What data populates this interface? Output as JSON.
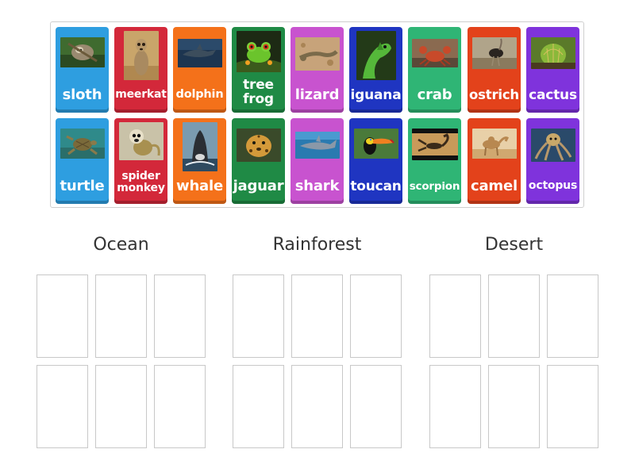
{
  "cards": [
    {
      "id": "sloth",
      "label": "sloth",
      "color": "#2e9ee0",
      "photo": "sloth-photo",
      "size": "18px"
    },
    {
      "id": "meerkat",
      "label": "meerkat",
      "color": "#d3283a",
      "photo": "meerkat-photo",
      "size": "14px"
    },
    {
      "id": "dolphin",
      "label": "dolphin",
      "color": "#f4711a",
      "photo": "dolphin-photo",
      "size": "14.5px"
    },
    {
      "id": "tree-frog",
      "label": "tree frog",
      "color": "#1f8a45",
      "photo": "frog-photo",
      "size": "17px"
    },
    {
      "id": "lizard",
      "label": "lizard",
      "color": "#c853cf",
      "photo": "lizard-photo",
      "size": "18px"
    },
    {
      "id": "iguana",
      "label": "iguana",
      "color": "#1f35c1",
      "photo": "iguana-photo",
      "size": "17px"
    },
    {
      "id": "crab",
      "label": "crab",
      "color": "#2fb575",
      "photo": "crab-photo",
      "size": "18px"
    },
    {
      "id": "ostrich",
      "label": "ostrich",
      "color": "#e3421b",
      "photo": "ostrich-photo",
      "size": "16.5px"
    },
    {
      "id": "cactus",
      "label": "cactus",
      "color": "#7f33dc",
      "photo": "cactus-photo",
      "size": "17px"
    },
    {
      "id": "turtle",
      "label": "turtle",
      "color": "#2e9ee0",
      "photo": "turtle-photo",
      "size": "18px"
    },
    {
      "id": "spider-monkey",
      "label": "spider monkey",
      "color": "#d3283a",
      "photo": "monkey-photo",
      "size": "14px"
    },
    {
      "id": "whale",
      "label": "whale",
      "color": "#f4711a",
      "photo": "whale-photo",
      "size": "18px"
    },
    {
      "id": "jaguar",
      "label": "jaguar",
      "color": "#1f8a45",
      "photo": "jaguar-photo",
      "size": "18px"
    },
    {
      "id": "shark",
      "label": "shark",
      "color": "#c853cf",
      "photo": "shark-photo",
      "size": "18px"
    },
    {
      "id": "toucan",
      "label": "toucan",
      "color": "#1f35c1",
      "photo": "toucan-photo",
      "size": "17px"
    },
    {
      "id": "scorpion",
      "label": "scorpion",
      "color": "#2fb575",
      "photo": "scorpion-photo",
      "size": "13.5px"
    },
    {
      "id": "camel",
      "label": "camel",
      "color": "#e3421b",
      "photo": "camel-photo",
      "size": "18px"
    },
    {
      "id": "octopus",
      "label": "octopus",
      "color": "#7f33dc",
      "photo": "octopus-photo",
      "size": "14px"
    }
  ],
  "groups": [
    {
      "id": "ocean",
      "title": "Ocean"
    },
    {
      "id": "rainforest",
      "title": "Rainforest"
    },
    {
      "id": "desert",
      "title": "Desert"
    }
  ]
}
